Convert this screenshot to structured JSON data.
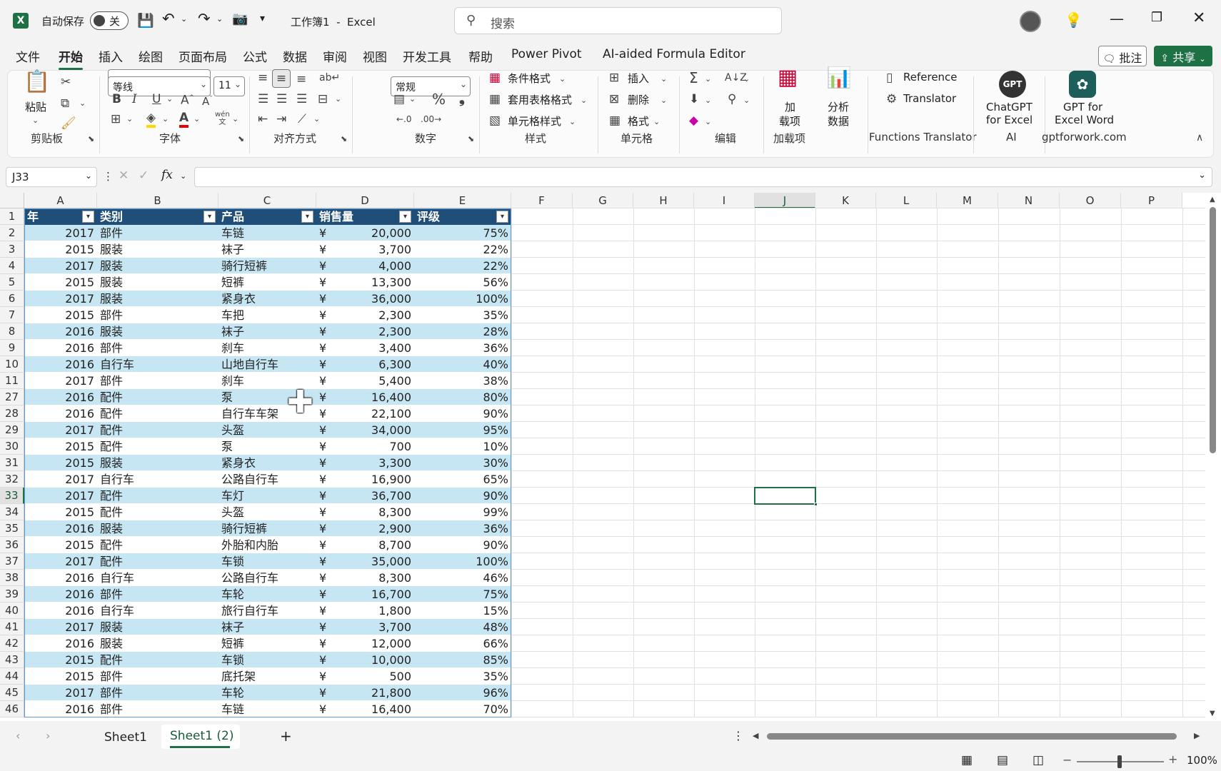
{
  "app": {
    "autosave_label": "自动保存",
    "autosave_state": "关",
    "document_title": "工作簿1  -  Excel",
    "search_placeholder": "搜索"
  },
  "menu": [
    "文件",
    "开始",
    "插入",
    "绘图",
    "页面布局",
    "公式",
    "数据",
    "审阅",
    "视图",
    "开发工具",
    "帮助",
    "Power Pivot",
    "AI-aided Formula Editor"
  ],
  "actions": {
    "comment": "批注",
    "share": "共享"
  },
  "ribbon": {
    "clipboard": {
      "paste": "粘贴",
      "label": "剪贴板"
    },
    "font": {
      "name": "等线",
      "size": "11",
      "label": "字体"
    },
    "alignment": {
      "label": "对齐方式"
    },
    "number": {
      "format": "常规",
      "label": "数字"
    },
    "styles": {
      "conditional": "条件格式",
      "table": "套用表格格式",
      "cell": "单元格样式",
      "label": "样式"
    },
    "cells": {
      "insert": "插入",
      "delete": "删除",
      "format": "格式",
      "label": "单元格"
    },
    "editing": {
      "label": "编辑"
    },
    "addins": {
      "button_line1": "加",
      "button_line2": "载项",
      "label": "加载项"
    },
    "analyze": {
      "line1": "分析",
      "line2": "数据"
    },
    "functions": {
      "reference": "Reference",
      "translator": "Translator",
      "label": "Functions Translator"
    },
    "ai": {
      "line1": "ChatGPT",
      "line2": "for Excel",
      "label": "AI"
    },
    "gptforwork": {
      "line1": "GPT for",
      "line2": "Excel Word",
      "label": "gptforwork.com"
    }
  },
  "formula_bar": {
    "name_box": "J33",
    "fx": "fx"
  },
  "columns": [
    "A",
    "B",
    "C",
    "D",
    "E",
    "F",
    "G",
    "H",
    "I",
    "J",
    "K",
    "L",
    "M",
    "N",
    "O",
    "P"
  ],
  "table_headers": [
    "年",
    "类别",
    "产品",
    "销售量",
    "评级"
  ],
  "rows": [
    {
      "n": "2",
      "year": "2017",
      "cat": "部件",
      "prod": "车链",
      "cur": "¥",
      "qty": "20,000",
      "rate": "75%"
    },
    {
      "n": "3",
      "year": "2015",
      "cat": "服装",
      "prod": "袜子",
      "cur": "¥",
      "qty": "3,700",
      "rate": "22%"
    },
    {
      "n": "4",
      "year": "2017",
      "cat": "服装",
      "prod": "骑行短裤",
      "cur": "¥",
      "qty": "4,000",
      "rate": "22%"
    },
    {
      "n": "5",
      "year": "2015",
      "cat": "服装",
      "prod": "短裤",
      "cur": "¥",
      "qty": "13,300",
      "rate": "56%"
    },
    {
      "n": "6",
      "year": "2017",
      "cat": "服装",
      "prod": "紧身衣",
      "cur": "¥",
      "qty": "36,000",
      "rate": "100%"
    },
    {
      "n": "7",
      "year": "2015",
      "cat": "部件",
      "prod": "车把",
      "cur": "¥",
      "qty": "2,300",
      "rate": "35%"
    },
    {
      "n": "8",
      "year": "2016",
      "cat": "服装",
      "prod": "袜子",
      "cur": "¥",
      "qty": "2,300",
      "rate": "28%"
    },
    {
      "n": "9",
      "year": "2016",
      "cat": "部件",
      "prod": "刹车",
      "cur": "¥",
      "qty": "3,400",
      "rate": "36%"
    },
    {
      "n": "10",
      "year": "2016",
      "cat": "自行车",
      "prod": "山地自行车",
      "cur": "¥",
      "qty": "6,300",
      "rate": "40%"
    },
    {
      "n": "11",
      "year": "2017",
      "cat": "部件",
      "prod": "刹车",
      "cur": "¥",
      "qty": "5,400",
      "rate": "38%"
    },
    {
      "n": "27",
      "year": "2016",
      "cat": "配件",
      "prod": "泵",
      "cur": "¥",
      "qty": "16,400",
      "rate": "80%"
    },
    {
      "n": "28",
      "year": "2016",
      "cat": "配件",
      "prod": "自行车车架",
      "cur": "¥",
      "qty": "22,100",
      "rate": "90%"
    },
    {
      "n": "29",
      "year": "2017",
      "cat": "配件",
      "prod": "头盔",
      "cur": "¥",
      "qty": "34,000",
      "rate": "95%"
    },
    {
      "n": "30",
      "year": "2015",
      "cat": "配件",
      "prod": "泵",
      "cur": "¥",
      "qty": "700",
      "rate": "10%"
    },
    {
      "n": "31",
      "year": "2015",
      "cat": "服装",
      "prod": "紧身衣",
      "cur": "¥",
      "qty": "3,300",
      "rate": "30%"
    },
    {
      "n": "32",
      "year": "2017",
      "cat": "自行车",
      "prod": "公路自行车",
      "cur": "¥",
      "qty": "16,900",
      "rate": "65%"
    },
    {
      "n": "33",
      "year": "2017",
      "cat": "配件",
      "prod": "车灯",
      "cur": "¥",
      "qty": "36,700",
      "rate": "90%"
    },
    {
      "n": "34",
      "year": "2015",
      "cat": "配件",
      "prod": "头盔",
      "cur": "¥",
      "qty": "8,300",
      "rate": "99%"
    },
    {
      "n": "35",
      "year": "2016",
      "cat": "服装",
      "prod": "骑行短裤",
      "cur": "¥",
      "qty": "2,900",
      "rate": "36%"
    },
    {
      "n": "36",
      "year": "2015",
      "cat": "配件",
      "prod": "外胎和内胎",
      "cur": "¥",
      "qty": "8,700",
      "rate": "90%"
    },
    {
      "n": "37",
      "year": "2017",
      "cat": "配件",
      "prod": "车锁",
      "cur": "¥",
      "qty": "35,000",
      "rate": "100%"
    },
    {
      "n": "38",
      "year": "2016",
      "cat": "自行车",
      "prod": "公路自行车",
      "cur": "¥",
      "qty": "8,300",
      "rate": "46%"
    },
    {
      "n": "39",
      "year": "2016",
      "cat": "部件",
      "prod": "车轮",
      "cur": "¥",
      "qty": "16,700",
      "rate": "75%"
    },
    {
      "n": "40",
      "year": "2016",
      "cat": "自行车",
      "prod": "旅行自行车",
      "cur": "¥",
      "qty": "1,800",
      "rate": "15%"
    },
    {
      "n": "41",
      "year": "2017",
      "cat": "服装",
      "prod": "袜子",
      "cur": "¥",
      "qty": "3,700",
      "rate": "48%"
    },
    {
      "n": "42",
      "year": "2016",
      "cat": "服装",
      "prod": "短裤",
      "cur": "¥",
      "qty": "12,000",
      "rate": "66%"
    },
    {
      "n": "43",
      "year": "2015",
      "cat": "配件",
      "prod": "车锁",
      "cur": "¥",
      "qty": "10,000",
      "rate": "85%"
    },
    {
      "n": "44",
      "year": "2015",
      "cat": "部件",
      "prod": "底托架",
      "cur": "¥",
      "qty": "500",
      "rate": "35%"
    },
    {
      "n": "45",
      "year": "2017",
      "cat": "部件",
      "prod": "车轮",
      "cur": "¥",
      "qty": "21,800",
      "rate": "96%"
    },
    {
      "n": "46",
      "year": "2016",
      "cat": "部件",
      "prod": "车链",
      "cur": "¥",
      "qty": "16,400",
      "rate": "70%"
    }
  ],
  "header_row_number": "1",
  "selected": {
    "column": "J",
    "row": "33"
  },
  "sheets": [
    "Sheet1",
    "Sheet1 (2)"
  ],
  "active_sheet": "Sheet1 (2)",
  "status": {
    "zoom": "100%"
  },
  "colors": {
    "excel_green": "#1e7145",
    "table_header": "#1f4e78",
    "band": "#c6e6f4"
  }
}
